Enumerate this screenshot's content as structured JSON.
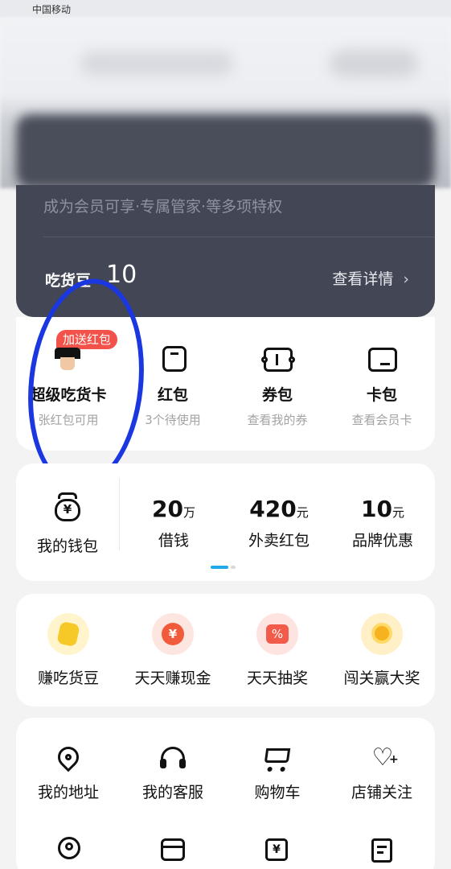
{
  "status_bar": {
    "carrier": "中国移动"
  },
  "member_card": {
    "perks": "成为会员可享·专属管家·等多项特权",
    "beans_label": "吃货豆",
    "beans_value": "10",
    "details_link": "查看详情",
    "chevron": "›"
  },
  "quick_entries": [
    {
      "badge": "加送红包",
      "label": "超级吃货卡",
      "sub": "张红包可用",
      "icon": "avatar-icon"
    },
    {
      "label": "红包",
      "sub": "3个待使用",
      "icon": "red-packet-icon"
    },
    {
      "label": "券包",
      "sub": "查看我的券",
      "icon": "coupon-icon"
    },
    {
      "label": "卡包",
      "sub": "查看会员卡",
      "icon": "card-icon"
    }
  ],
  "wallet": {
    "title": "我的钱包",
    "items": [
      {
        "value": "20",
        "unit": "万",
        "label": "借钱"
      },
      {
        "value": "420",
        "unit": "元",
        "label": "外卖红包"
      },
      {
        "value": "10",
        "unit": "元",
        "label": "品牌优惠"
      }
    ]
  },
  "activities": [
    {
      "label": "赚吃货豆",
      "icon": "gold-bean-icon",
      "color": "#f7c928"
    },
    {
      "label": "天天赚现金",
      "icon": "money-bag-icon",
      "color": "#f25a3c"
    },
    {
      "label": "天天抽奖",
      "icon": "lottery-ticket-icon",
      "color": "#f25a4a"
    },
    {
      "label": "闯关赢大奖",
      "icon": "trophy-coin-icon",
      "color": "#f6b21f"
    }
  ],
  "services": [
    {
      "label": "我的地址",
      "icon": "location-pin-icon"
    },
    {
      "label": "我的客服",
      "icon": "headset-icon"
    },
    {
      "label": "购物车",
      "icon": "cart-icon"
    },
    {
      "label": "店铺关注",
      "icon": "heart-plus-icon"
    }
  ],
  "services_row2": [
    {
      "icon": "user-group-icon"
    },
    {
      "icon": "store-icon"
    },
    {
      "icon": "yen-calendar-icon"
    },
    {
      "icon": "receipt-icon"
    }
  ],
  "colors": {
    "accent_blue": "#21a8e8",
    "annotation": "#1a37e0",
    "member_card_bg": "#434755",
    "badge_red": "#f2524a"
  }
}
